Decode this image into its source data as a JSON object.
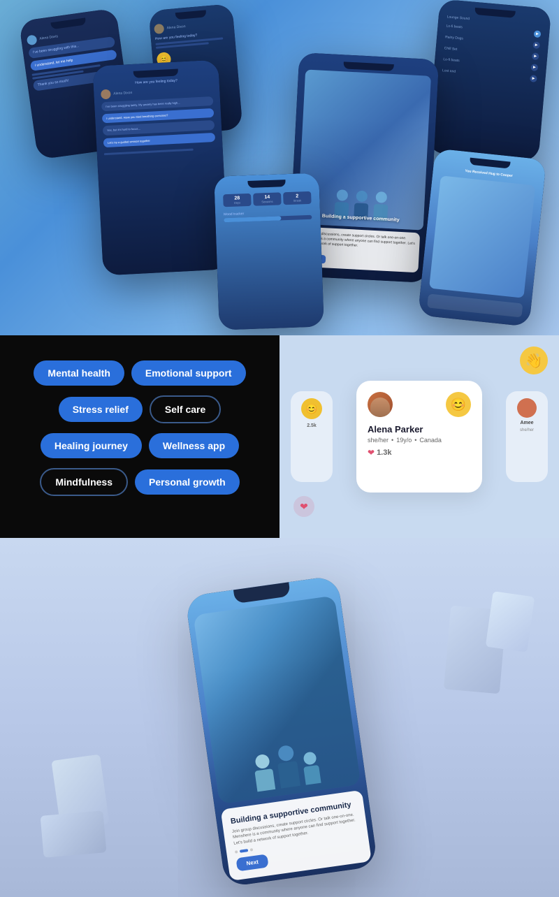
{
  "section1": {
    "background": "blue-gradient",
    "phones": [
      {
        "id": "phone-1",
        "type": "messaging",
        "position": "top-left"
      },
      {
        "id": "phone-2",
        "type": "profile",
        "position": "top-center"
      },
      {
        "id": "phone-3",
        "type": "music",
        "position": "top-right"
      },
      {
        "id": "phone-4",
        "type": "chat",
        "position": "center-left"
      },
      {
        "id": "phone-5",
        "type": "community",
        "position": "center-right"
      },
      {
        "id": "phone-6",
        "type": "notification",
        "position": "bottom-right"
      },
      {
        "id": "phone-7",
        "type": "stats",
        "position": "bottom-center"
      }
    ],
    "community_text": "Building a supportive community",
    "community_desc": "Join group discussions, create support circles. Or talk one-on-one. Menshere is a community where anyone can find support together. Let's build a network of support together."
  },
  "section2": {
    "left_panel": {
      "background": "dark",
      "tags": [
        {
          "label": "Mental health",
          "style": "filled",
          "row": 1
        },
        {
          "label": "Emotional support",
          "style": "filled",
          "row": 1
        },
        {
          "label": "Stress relief",
          "style": "filled",
          "row": 2
        },
        {
          "label": "Self care",
          "style": "outlined",
          "row": 2
        },
        {
          "label": "Healing journey",
          "style": "filled",
          "row": 3
        },
        {
          "label": "Wellness app",
          "style": "filled",
          "row": 3
        },
        {
          "label": "Mindfulness",
          "style": "outlined",
          "row": 4
        },
        {
          "label": "Personal growth",
          "style": "filled",
          "row": 4
        }
      ]
    },
    "right_panel": {
      "background": "light-blue",
      "wave_emoji": "👋",
      "heart_emoji": "❤️",
      "profile_card": {
        "name": "Alena Parker",
        "pronouns": "she/her",
        "age": "19y/o",
        "location": "Canada",
        "likes": "1.3k",
        "badge_emoji": "😊"
      },
      "side_card_name": "Amee",
      "side_card_pronouns": "she/her"
    }
  },
  "section3": {
    "background": "light-blue-gradient",
    "phone": {
      "screen_title": "Building a supportive community",
      "screen_desc": "Join group discussions, create support circles. Or talk one-on-one. Menshere is a community where anyone can find support together. Let's build a network of support together.",
      "next_button": "Next",
      "dots": [
        {
          "active": false
        },
        {
          "active": true
        },
        {
          "active": false
        }
      ]
    }
  }
}
